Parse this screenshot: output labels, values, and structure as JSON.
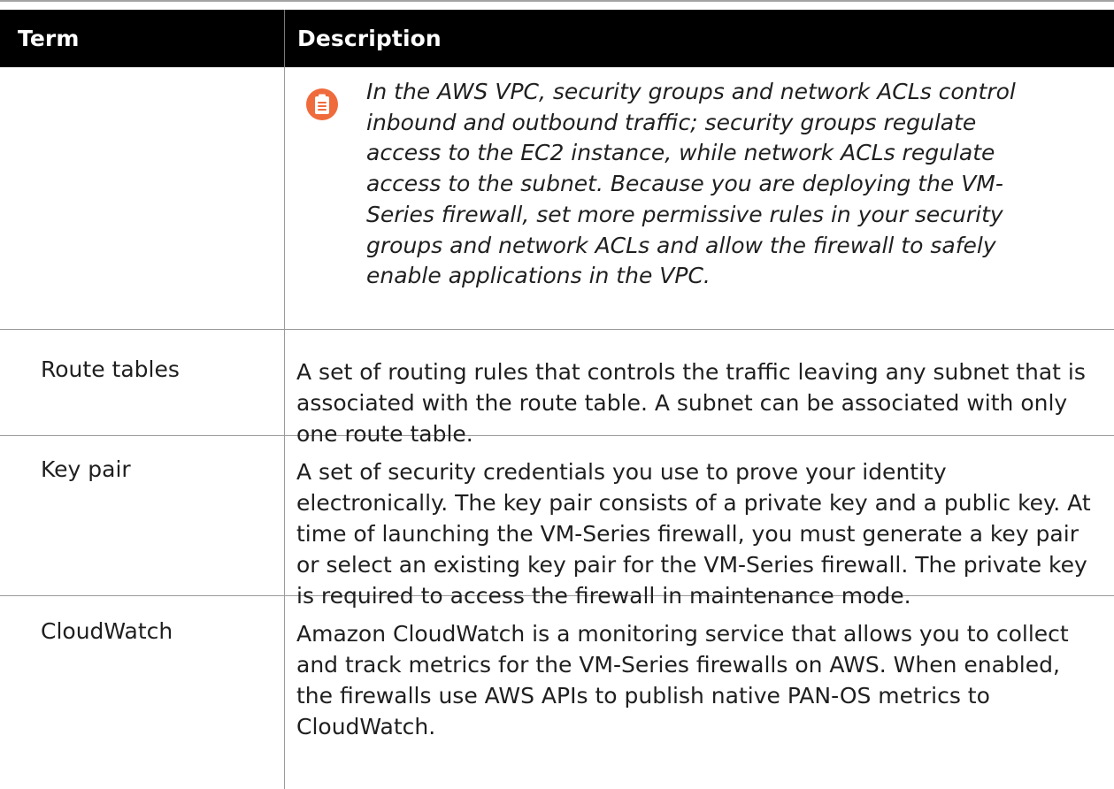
{
  "table": {
    "headers": {
      "term": "Term",
      "description": "Description"
    },
    "note": {
      "text": "In the AWS VPC, security groups and network ACLs control inbound and outbound traffic; security groups regulate access to the EC2 instance, while network ACLs regulate access to the subnet. Because you are deploying the VM-Series firewall, set more permissive rules in your security groups and network ACLs and allow the firewall to safely enable applications in the VPC.",
      "icon": "clipboard-note-icon",
      "icon_color": "#ef6b3c"
    },
    "rows": [
      {
        "term": "Route tables",
        "description": "A set of routing rules that controls the traffic leaving any subnet that is associated with the route table. A subnet can be associated with only one route table."
      },
      {
        "term": "Key pair",
        "description": "A set of security credentials you use to prove your identity electronically. The key pair consists of a private key and a public key. At time of launching the VM-Series firewall, you must generate a key pair or select an existing key pair for the VM-Series firewall. The private key is required to access the firewall in maintenance mode."
      },
      {
        "term": "CloudWatch",
        "description": "Amazon CloudWatch is a monitoring service that allows you to collect and track metrics for the VM-Series firewalls on AWS. When enabled, the firewalls use AWS APIs to publish native PAN-OS metrics to CloudWatch."
      }
    ]
  },
  "colors": {
    "header_background": "#000000",
    "header_text": "#ffffff",
    "body_text": "#1f1f1f",
    "border": "#9b9b9b",
    "accent": "#ef6b3c"
  }
}
